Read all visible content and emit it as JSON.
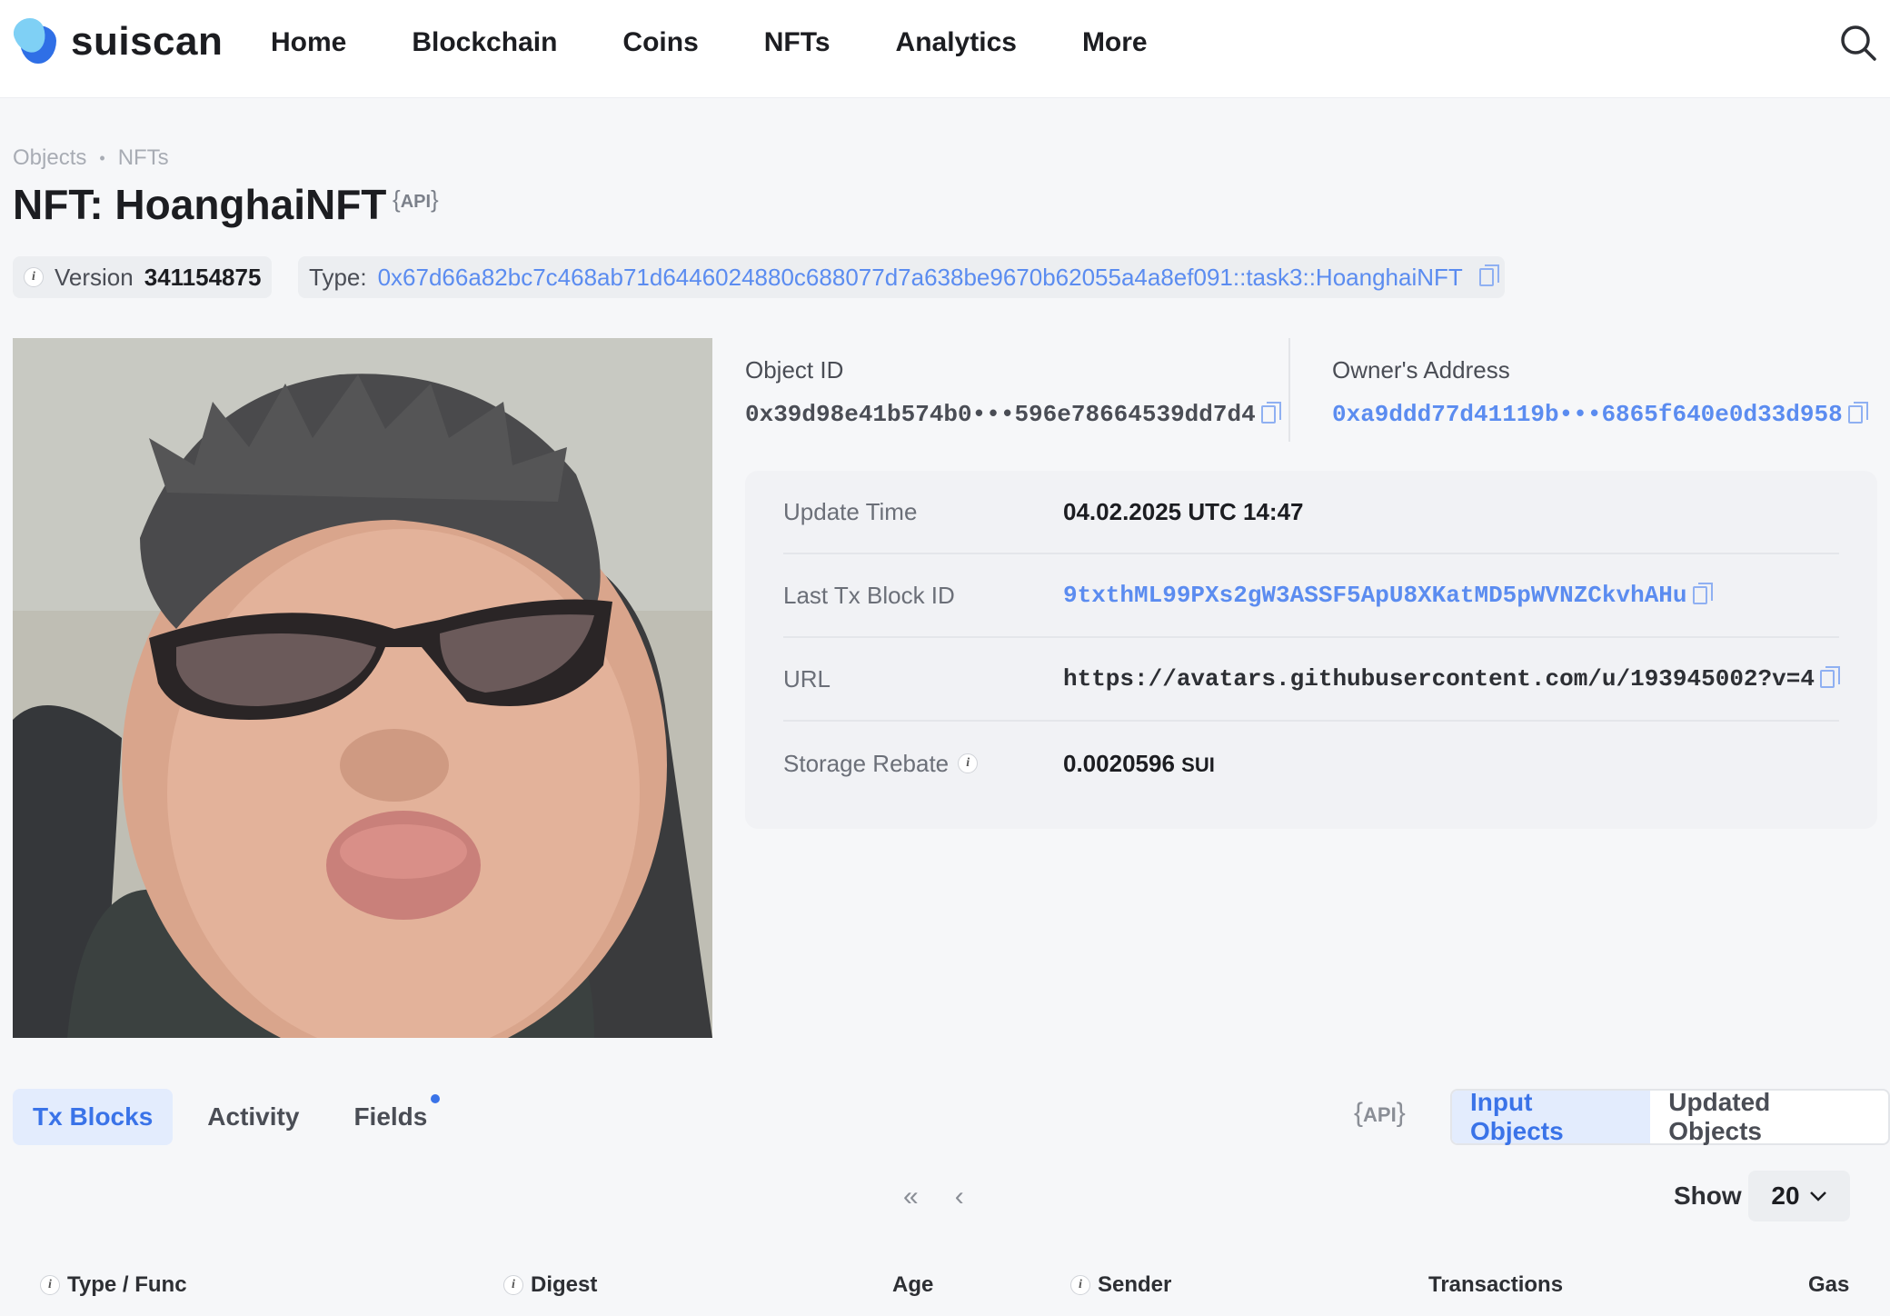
{
  "header": {
    "brand": "suiscan",
    "nav": [
      "Home",
      "Blockchain",
      "Coins",
      "NFTs",
      "Analytics",
      "More"
    ]
  },
  "breadcrumb": [
    "Objects",
    "NFTs"
  ],
  "page": {
    "title": "NFT: HoanghaiNFT",
    "api_label": "API"
  },
  "version": {
    "label": "Version",
    "value": "341154875"
  },
  "type": {
    "label": "Type:",
    "value": "0x67d66a82bc7c468ab71d6446024880c688077d7a638be9670b62055a4a8ef091::task3::HoanghaiNFT"
  },
  "object": {
    "id_label": "Object ID",
    "id_value": "0x39d98e41b574b0•••596e78664539dd7d4",
    "owner_label": "Owner's Address",
    "owner_value": "0xa9ddd77d41119b•••6865f640e0d33d958"
  },
  "details": [
    {
      "key": "Update Time",
      "value": "04.02.2025 UTC 14:47"
    },
    {
      "key": "Last Tx Block ID",
      "value": "9txthML99PXs2gW3ASSF5ApU8XKatMD5pWVNZCkvhAHu"
    },
    {
      "key": "URL",
      "value": "https://avatars.githubusercontent.com/u/193945002?v=4"
    },
    {
      "key": "Storage Rebate",
      "value": "0.0020596",
      "unit": "SUI"
    }
  ],
  "tabs": [
    "Tx Blocks",
    "Activity",
    "Fields"
  ],
  "api_label2": "API",
  "toggle": [
    "Input Objects",
    "Updated Objects"
  ],
  "pager": {
    "first": "«",
    "prev": "‹"
  },
  "show": {
    "label": "Show",
    "value": "20"
  },
  "table_headers": [
    "Type / Func",
    "Digest",
    "Age",
    "Sender",
    "Transactions",
    "Gas"
  ]
}
